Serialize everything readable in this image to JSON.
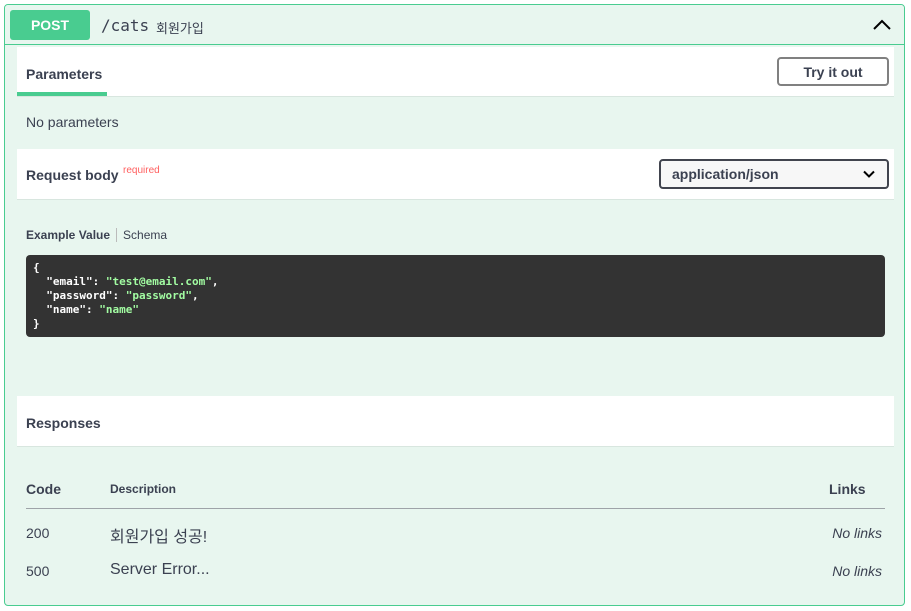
{
  "operation": {
    "method": "POST",
    "path": "/cats",
    "summary": "회원가입"
  },
  "parameters": {
    "tab_label": "Parameters",
    "try_button": "Try it out",
    "empty_text": "No parameters"
  },
  "request_body": {
    "title": "Request body",
    "required_label": "required",
    "content_type": "application/json",
    "tabs": {
      "example": "Example Value",
      "schema": "Schema"
    },
    "example": {
      "open_brace": "{",
      "close_brace": "}",
      "lines": [
        {
          "key": "\"email\"",
          "value": "\"test@email.com\"",
          "comma": ","
        },
        {
          "key": "\"password\"",
          "value": "\"password\"",
          "comma": ","
        },
        {
          "key": "\"name\"",
          "value": "\"name\"",
          "comma": ""
        }
      ]
    }
  },
  "responses": {
    "title": "Responses",
    "columns": {
      "code": "Code",
      "description": "Description",
      "links": "Links"
    },
    "rows": [
      {
        "code": "200",
        "description": "회원가입 성공!",
        "links": "No links"
      },
      {
        "code": "500",
        "description": "Server Error...",
        "links": "No links"
      }
    ]
  },
  "colors": {
    "post_accent": "#49cc90",
    "post_background": "#e8f6ef",
    "code_background": "#333333",
    "code_string": "#a2fca2",
    "required": "#ff6060"
  },
  "icons": {
    "collapse": "chevron-up-icon",
    "select": "chevron-down-icon"
  }
}
